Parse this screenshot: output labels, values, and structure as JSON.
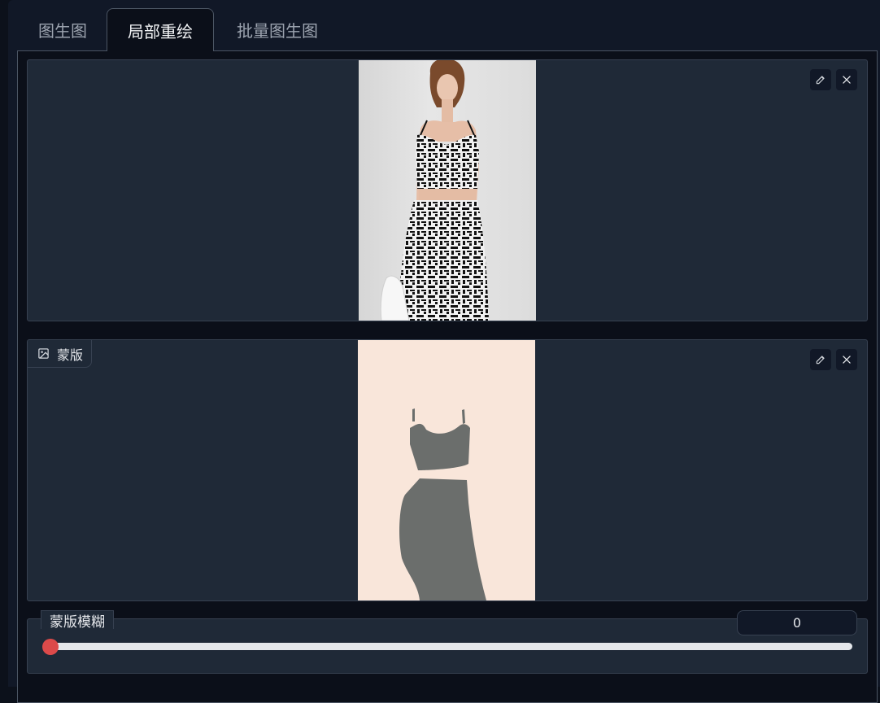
{
  "tabs": [
    {
      "label": "图生图",
      "active": false
    },
    {
      "label": "局部重绘",
      "active": true
    },
    {
      "label": "批量图生图",
      "active": false
    }
  ],
  "mask_box": {
    "label": "蒙版"
  },
  "slider": {
    "label": "蒙版模糊",
    "value": "0",
    "fraction": 0
  },
  "icons": {
    "edit": "pencil-icon",
    "close": "close-icon",
    "image": "image-icon"
  },
  "colors": {
    "accent": "#dc4a4a",
    "mask_background": "#f9e6da",
    "mask_shape": "#6b6e6c",
    "panel": "#1f2937"
  }
}
